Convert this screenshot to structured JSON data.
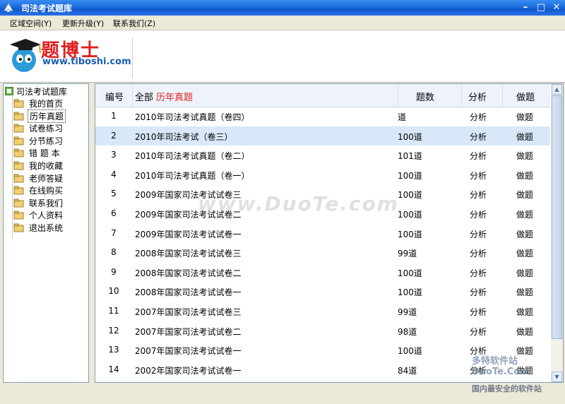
{
  "window": {
    "title": "司法考试题库"
  },
  "menu": [
    {
      "label": "区域空间(Y)"
    },
    {
      "label": "更新升级(Y)"
    },
    {
      "label": "联系我们(Z)"
    }
  ],
  "logo": {
    "name": "题博士",
    "url": "www.tiboshi.com"
  },
  "tree": {
    "root": "司法考试题库",
    "items": [
      {
        "label": "我的首页"
      },
      {
        "label": "历年真题",
        "selected": true
      },
      {
        "label": "试卷练习"
      },
      {
        "label": "分节练习"
      },
      {
        "label": "错 题 本"
      },
      {
        "label": "我的收藏"
      },
      {
        "label": "老师答疑"
      },
      {
        "label": "在线购买"
      },
      {
        "label": "联系我们"
      },
      {
        "label": "个人资料"
      },
      {
        "label": "退出系统"
      }
    ]
  },
  "grid": {
    "headers": {
      "num": "编号",
      "all": "全部",
      "category": "历年真题",
      "count": "题数",
      "analyze": "分析",
      "practice": "做题"
    },
    "rows": [
      {
        "num": "1",
        "name": "2010年司法考试真题（卷四）",
        "count": "道",
        "analyze": "分析",
        "practice": "做题"
      },
      {
        "num": "2",
        "name": "2010年司法考试（卷三）",
        "count": "100道",
        "analyze": "分析",
        "practice": "做题",
        "selected": true
      },
      {
        "num": "3",
        "name": "2010年司法考试真题（卷二）",
        "count": "101道",
        "analyze": "分析",
        "practice": "做题"
      },
      {
        "num": "4",
        "name": "2010年司法考试真题（卷一）",
        "count": "100道",
        "analyze": "分析",
        "practice": "做题"
      },
      {
        "num": "5",
        "name": "2009年国家司法考试试卷三",
        "count": "100道",
        "analyze": "分析",
        "practice": "做题"
      },
      {
        "num": "6",
        "name": "2009年国家司法考试试卷二",
        "count": "100道",
        "analyze": "分析",
        "practice": "做题"
      },
      {
        "num": "7",
        "name": "2009年国家司法考试试卷一",
        "count": "100道",
        "analyze": "分析",
        "practice": "做题"
      },
      {
        "num": "8",
        "name": "2008年国家司法考试试卷三",
        "count": "99道",
        "analyze": "分析",
        "practice": "做题"
      },
      {
        "num": "9",
        "name": "2008年国家司法考试试卷二",
        "count": "100道",
        "analyze": "分析",
        "practice": "做题"
      },
      {
        "num": "10",
        "name": "2008年国家司法考试试卷一",
        "count": "100道",
        "analyze": "分析",
        "practice": "做题"
      },
      {
        "num": "11",
        "name": "2007年国家司法考试试卷三",
        "count": "99道",
        "analyze": "分析",
        "practice": "做题"
      },
      {
        "num": "12",
        "name": "2007年国家司法考试试卷二",
        "count": "98道",
        "analyze": "分析",
        "practice": "做题"
      },
      {
        "num": "13",
        "name": "2007年国家司法考试试卷一",
        "count": "100道",
        "analyze": "分析",
        "practice": "做题"
      },
      {
        "num": "14",
        "name": "2002年国家司法考试试卷一",
        "count": "84道",
        "analyze": "分析",
        "practice": "做题"
      }
    ]
  },
  "watermarks": {
    "main": "www.DuoTe.com",
    "corner": "DuoTe.Com",
    "corner_cn": "多特软件站",
    "footer": "国内最安全的软件站"
  },
  "colors": {
    "title_bar": "#1f6fe0",
    "category_red": "#e02020",
    "logo_url": "#1a5fb4",
    "selected_row": "#d8e8f8"
  }
}
